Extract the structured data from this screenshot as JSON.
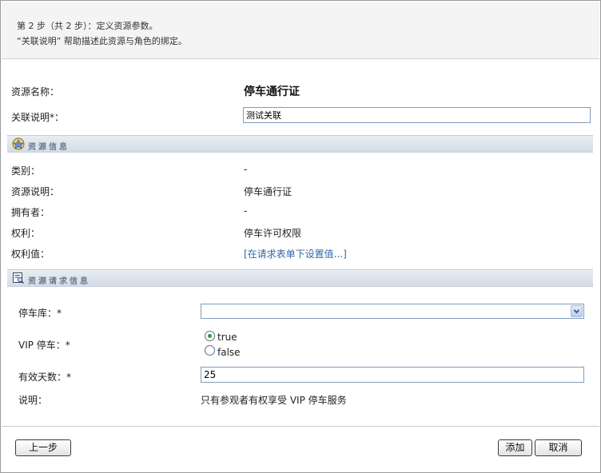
{
  "header": {
    "step": "第 2 步（共 2 步）：定义资源参数。",
    "hint": "“关联说明” 帮助描述此资源与角色的绑定。"
  },
  "resource_name": {
    "label": "资源名称：",
    "value": "停车通行证"
  },
  "assoc_desc": {
    "label": "关联说明*：",
    "value": "测试关联"
  },
  "resource_info": {
    "title": "资源信息",
    "icon": "resource-icon",
    "rows": [
      {
        "label": "类别：",
        "value": "-"
      },
      {
        "label": "资源说明：",
        "value": "停车通行证"
      },
      {
        "label": "拥有者：",
        "value": "-"
      },
      {
        "label": "权利：",
        "value": "停车许可权限"
      },
      {
        "label": "权利值：",
        "value": "[在请求表单下设置值...]"
      }
    ]
  },
  "request_info": {
    "title": "资源请求信息",
    "icon": "form-icon",
    "garage": {
      "label": "停车库：*",
      "value": ""
    },
    "vip": {
      "label": "VIP 停车：*",
      "options": [
        "true",
        "false"
      ],
      "selected": "true"
    },
    "valid_days": {
      "label": "有效天数：*",
      "value": "25"
    },
    "note": {
      "label": "说明：",
      "value": "只有参观者有权享受 VIP 停车服务"
    }
  },
  "buttons": {
    "back": "上一步",
    "add": "添加",
    "cancel": "取消"
  }
}
